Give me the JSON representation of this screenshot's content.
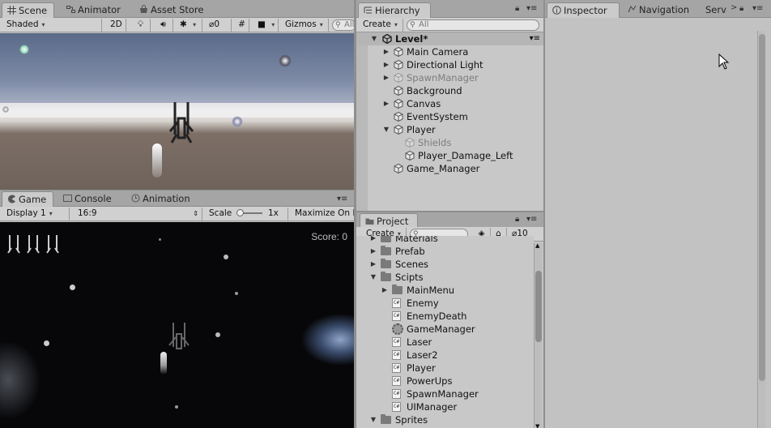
{
  "scene": {
    "tabs": [
      "Scene",
      "Animator",
      "Asset Store"
    ],
    "shading": "Shaded",
    "mode2d": "2D",
    "effects_count": "0",
    "gizmos": "Gizmos",
    "search_placeholder": "All"
  },
  "game": {
    "tabs": [
      "Game",
      "Console",
      "Animation"
    ],
    "display": "Display 1",
    "aspect": "16:9",
    "scale_label": "Scale",
    "scale_value": "1x",
    "maximize": "Maximize On P",
    "score": "Score: 0",
    "lives": 3
  },
  "hierarchy": {
    "tab": "Hierarchy",
    "create": "Create",
    "search_placeholder": "All",
    "scene_name": "Level*",
    "items": [
      {
        "label": "Main Camera",
        "arrow": "right",
        "indent": 0,
        "dim": false
      },
      {
        "label": "Directional Light",
        "arrow": "right",
        "indent": 0,
        "dim": false
      },
      {
        "label": "SpawnManager",
        "arrow": "right",
        "indent": 0,
        "dim": true
      },
      {
        "label": "Background",
        "arrow": "none",
        "indent": 0,
        "dim": false
      },
      {
        "label": "Canvas",
        "arrow": "right",
        "indent": 0,
        "dim": false
      },
      {
        "label": "EventSystem",
        "arrow": "none",
        "indent": 0,
        "dim": false
      },
      {
        "label": "Player",
        "arrow": "down",
        "indent": 0,
        "dim": false
      },
      {
        "label": "Shields",
        "arrow": "none",
        "indent": 1,
        "dim": true
      },
      {
        "label": "Player_Damage_Left",
        "arrow": "none",
        "indent": 1,
        "dim": false
      },
      {
        "label": "Game_Manager",
        "arrow": "none",
        "indent": 0,
        "dim": false
      }
    ]
  },
  "project": {
    "tab": "Project",
    "create": "Create",
    "hidden_count": "10",
    "items": [
      {
        "label": "Materials",
        "type": "folder",
        "arrow": "right",
        "indent": 0
      },
      {
        "label": "Prefab",
        "type": "folder",
        "arrow": "right",
        "indent": 0
      },
      {
        "label": "Scenes",
        "type": "folder",
        "arrow": "right",
        "indent": 0
      },
      {
        "label": "Scipts",
        "type": "folder",
        "arrow": "down",
        "indent": 0
      },
      {
        "label": "MainMenu",
        "type": "folder",
        "arrow": "right",
        "indent": 1
      },
      {
        "label": "Enemy",
        "type": "cs",
        "arrow": "none",
        "indent": 1
      },
      {
        "label": "EnemyDeath",
        "type": "cs",
        "arrow": "none",
        "indent": 1
      },
      {
        "label": "GameManager",
        "type": "gear",
        "arrow": "none",
        "indent": 1
      },
      {
        "label": "Laser",
        "type": "cs",
        "arrow": "none",
        "indent": 1
      },
      {
        "label": "Laser2",
        "type": "cs",
        "arrow": "none",
        "indent": 1
      },
      {
        "label": "Player",
        "type": "cs",
        "arrow": "none",
        "indent": 1
      },
      {
        "label": "PowerUps",
        "type": "cs",
        "arrow": "none",
        "indent": 1
      },
      {
        "label": "SpawnManager",
        "type": "cs",
        "arrow": "none",
        "indent": 1
      },
      {
        "label": "UIManager",
        "type": "cs",
        "arrow": "none",
        "indent": 1
      },
      {
        "label": "Sprites",
        "type": "folder",
        "arrow": "down",
        "indent": 0
      }
    ]
  },
  "inspector": {
    "tabs": [
      "Inspector",
      "Navigation",
      "Serv"
    ]
  }
}
